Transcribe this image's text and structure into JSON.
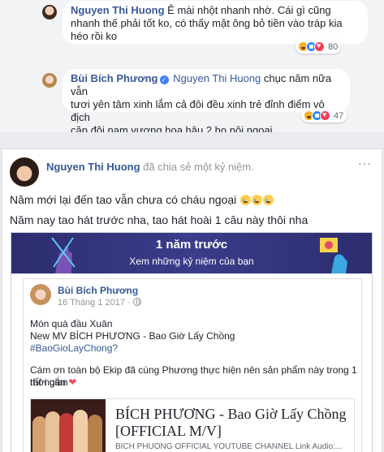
{
  "comments": [
    {
      "author": "Nguyen Thi Huong",
      "text": "Ê mài nhột nhanh nhờ. Cái gì cũng nhanh thế phải tốt ko, có thấy mặt ông bỏ tiền vào tráp kia héo rồi ko",
      "line1": "Ê mài nhột nhanh nhờ. Cái gì cũng",
      "line2": "nhanh thế phải tốt ko, có thấy mặt ông bỏ tiền vào tráp kia",
      "line3": "héo rồi ko",
      "reaction_count": "80"
    },
    {
      "author": "Bùi Bích Phương",
      "tagged": "Nguyen Thi Huong",
      "line1": "chục năm nữa vẫn",
      "line2": "tươi yên tâm xinh lắm cả đôi đều xinh trẻ đỉnh điểm vô địch",
      "line3": "cặp đôi nam vương hoa hậu 2 họ nội ngoại",
      "reaction_count": "47"
    }
  ],
  "post": {
    "author": "Nguyen Thi Huong",
    "action": "đã chia sẻ một kỷ niệm.",
    "more": "···",
    "line1": "Năm mới lại đến tao vẫn chưa có cháu ngoại",
    "line2": "Năm nay tao hát trước nha, tao hát hoài 1 câu này thôi nha",
    "memory": {
      "title": "1 năm trước",
      "subtitle": "Xem những kỷ niệm của bạn"
    },
    "shared": {
      "author": "Bùi Bích Phương",
      "date": "16 Tháng 1 2017 ·",
      "line1": "Món quà đầu Xuân",
      "line2": "New MV BÍCH PHƯƠNG - Bao Giờ Lấy Chồng",
      "line3": "#BaoGioLayChong?",
      "line4": "Cám ơn toàn bộ Ekip đã cùng Phương thực hiện nên sản phẩm này trong 1 thời gian",
      "line5": "rất ngắn",
      "link": {
        "title_line1": "BÍCH PHƯƠNG - Bao Giờ Lấy Chồng",
        "title_line2": "[OFFICIAL M/V]",
        "source": "BICH PHUONG OFFICIAL YOUTUBE CHANNEL Link Audio:..."
      }
    }
  },
  "colors": {
    "link_blue": "#385898",
    "banner": "#2c2d6e",
    "page_bg": "#e9ebee"
  }
}
